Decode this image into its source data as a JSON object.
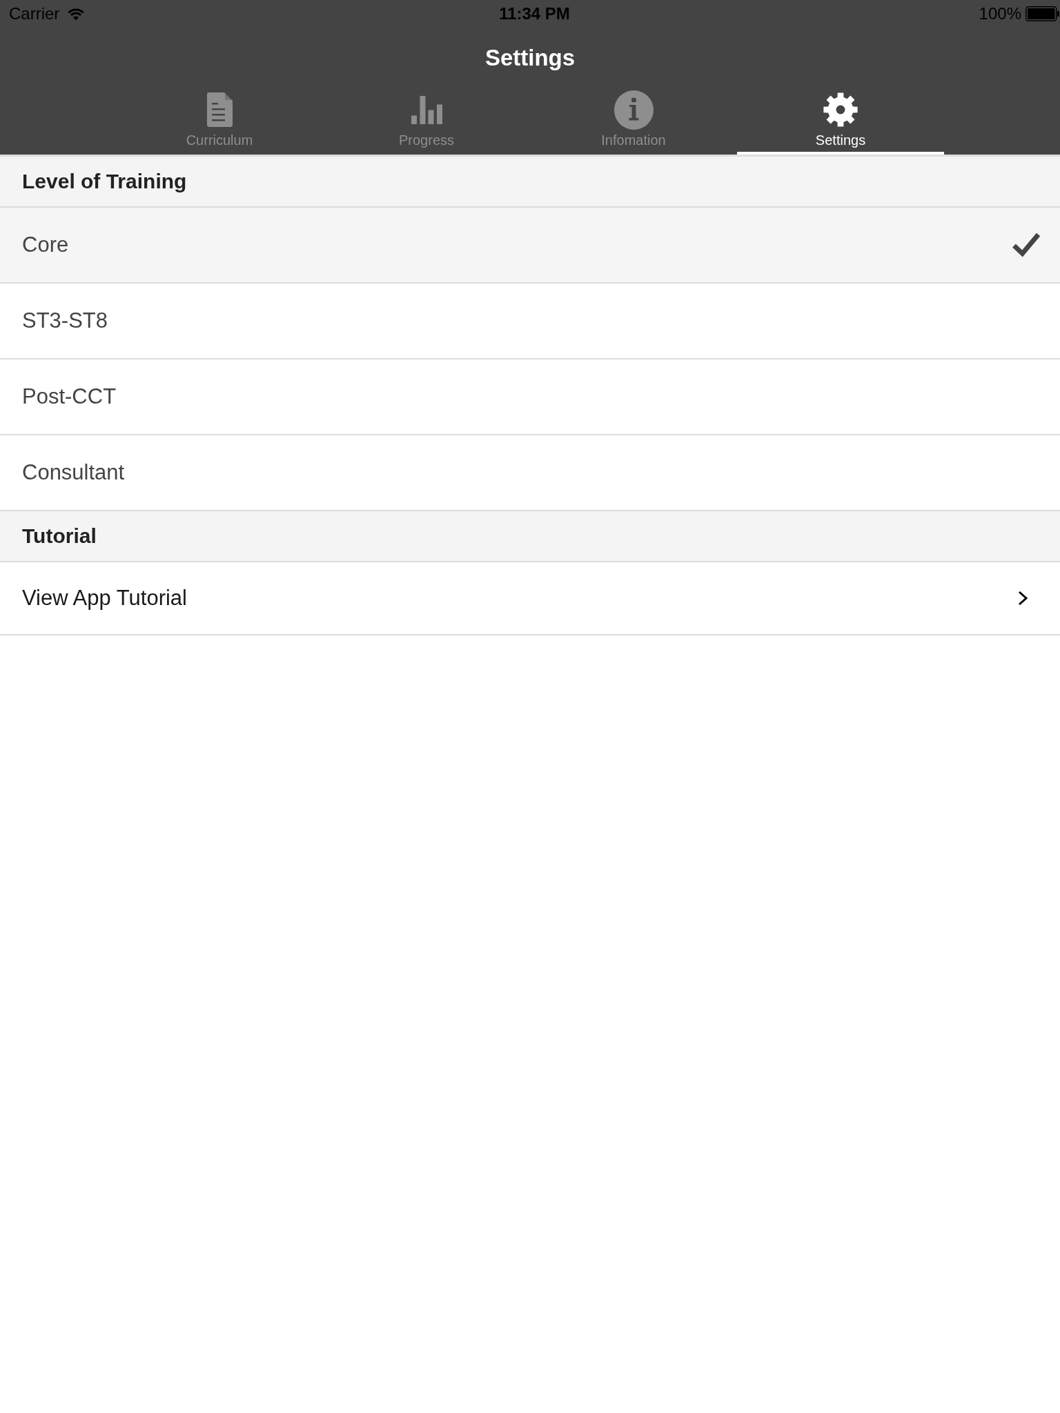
{
  "status_bar": {
    "carrier": "Carrier",
    "time": "11:34 PM",
    "battery": "100%"
  },
  "nav": {
    "title": "Settings"
  },
  "tabs": [
    {
      "label": "Curriculum",
      "kind": "document",
      "selected": false
    },
    {
      "label": "Progress",
      "kind": "chart",
      "selected": false
    },
    {
      "label": "Infomation",
      "kind": "info",
      "selected": false
    },
    {
      "label": "Settings",
      "kind": "gear",
      "selected": true
    }
  ],
  "sections": [
    {
      "title": "Level of Training",
      "rows": [
        {
          "kind": "option",
          "label": "Core",
          "selected": true
        },
        {
          "kind": "option",
          "label": "ST3-ST8",
          "selected": false
        },
        {
          "kind": "option",
          "label": "Post-CCT",
          "selected": false
        },
        {
          "kind": "option",
          "label": "Consultant",
          "selected": false
        }
      ]
    },
    {
      "title": "Tutorial",
      "rows": [
        {
          "kind": "link",
          "label": "View App Tutorial"
        }
      ]
    }
  ]
}
